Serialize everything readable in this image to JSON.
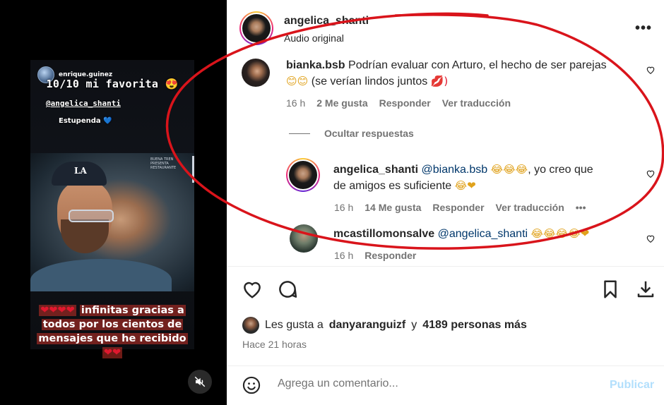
{
  "story": {
    "username": "enrique.guinez",
    "line1": "10/10 mi favorita 😍",
    "line2": "@angelica_shanti",
    "line3": "Estupenda",
    "line3_heart": "💙",
    "cap_logo": "LA",
    "sign_text": "BUENA TREN PRESENTA RESTAURANTE",
    "bottom_hearts": "❤❤❤❤",
    "bottom_line1": "infinitas gracias a",
    "bottom_line2": "todos por los cientos de",
    "bottom_line3": "mensajes que he recibido",
    "bottom_tail_hearts": "❤❤"
  },
  "header": {
    "username": "angelica_shanti",
    "audio": "Audio original"
  },
  "comments": [
    {
      "user": "bianka.bsb",
      "text": "Podrían evaluar con Arturo, el hecho de ser parejas",
      "text2_pre": "😊😊",
      "text2": "(se verían lindos juntos",
      "text2_post": "💋)",
      "time": "16 h",
      "likes": "2 Me gusta",
      "reply": "Responder",
      "translate": "Ver traducción"
    },
    {
      "user": "angelica_shanti",
      "mention": "@bianka.bsb",
      "emojis": "😂😂😂",
      "text": ", yo creo que",
      "text2": "de amigos es suficiente",
      "text2_emojis": "😂❤",
      "time": "16 h",
      "likes": "14 Me gusta",
      "reply": "Responder",
      "translate": "Ver traducción",
      "more": "•••"
    },
    {
      "user": "mcastillomonsalve",
      "mention": "@angelica_shanti",
      "emojis": "😂😂😂😂❤",
      "time": "16 h",
      "reply": "Responder"
    }
  ],
  "hide_replies": "Ocultar respuestas",
  "likes": {
    "prefix": "Les gusta a",
    "user": "danyaranguizf",
    "middle": "y",
    "count": "4189 personas más"
  },
  "time_ago": "Hace 21 horas",
  "add_comment": {
    "placeholder": "Agrega un comentario...",
    "publish": "Publicar"
  },
  "colors": {
    "link": "#00376b",
    "muted": "#737373",
    "publish_disabled": "#b2dffc",
    "annotation": "#d9141b"
  },
  "icons": [
    "heart-icon",
    "comment-icon",
    "bookmark-icon",
    "download-icon",
    "emoji-icon",
    "more-icon",
    "mute-icon"
  ]
}
